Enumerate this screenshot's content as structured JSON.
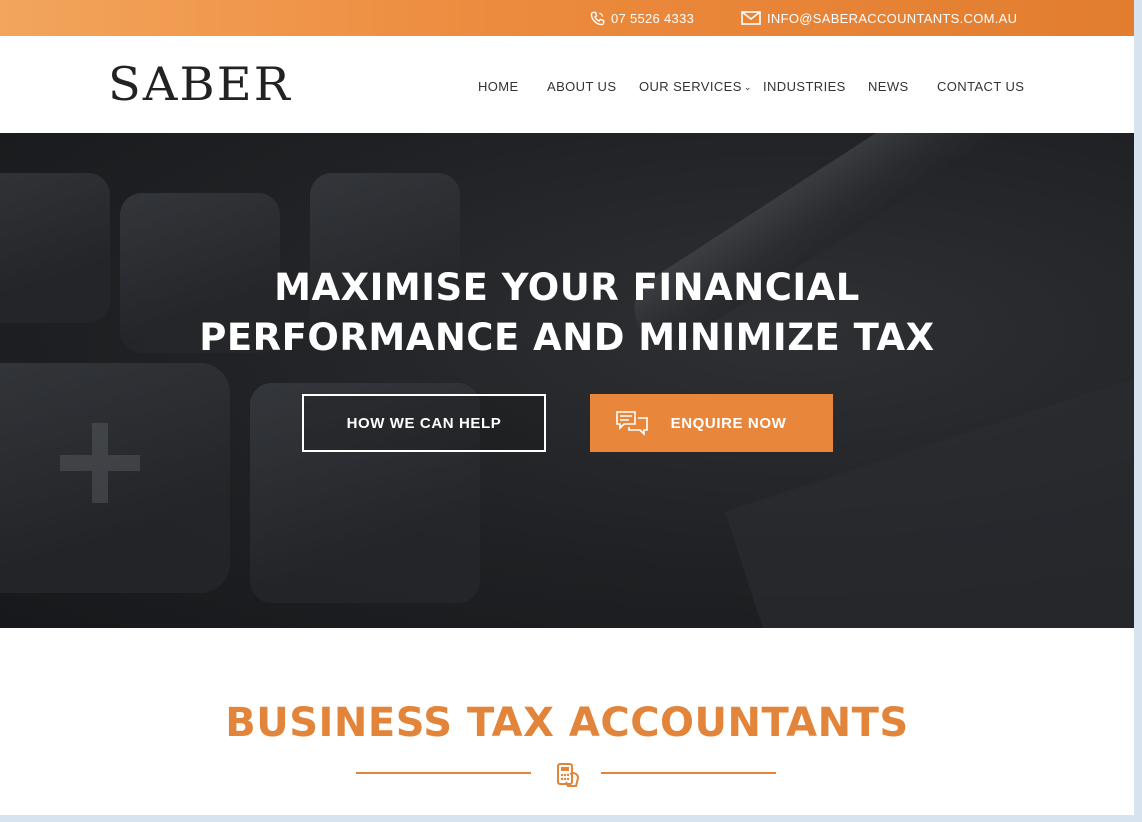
{
  "topbar": {
    "phone": "07 5526 4333",
    "email": "INFO@SABERACCOUNTANTS.COM.AU",
    "phone_icon": "phone-icon",
    "email_icon": "envelope-icon"
  },
  "header": {
    "logo": "SABER",
    "nav": [
      {
        "label": "HOME"
      },
      {
        "label": "ABOUT US"
      },
      {
        "label": "OUR SERVICES"
      },
      {
        "label": "INDUSTRIES"
      },
      {
        "label": "NEWS"
      },
      {
        "label": "CONTACT US"
      }
    ]
  },
  "hero": {
    "title_line1": "MAXIMISE YOUR FINANCIAL",
    "title_line2": "PERFORMANCE AND MINIMIZE TAX",
    "btn_help": "HOW WE CAN HELP",
    "btn_enquire": "ENQUIRE NOW",
    "enquire_icon": "chat-bubbles-icon"
  },
  "section": {
    "title": "BUSINESS TAX ACCOUNTANTS",
    "divider_icon": "calculator-hand-icon"
  },
  "colors": {
    "accent": "#e8873b",
    "hero_bg": "#1f2124",
    "text_dark": "#333333"
  }
}
